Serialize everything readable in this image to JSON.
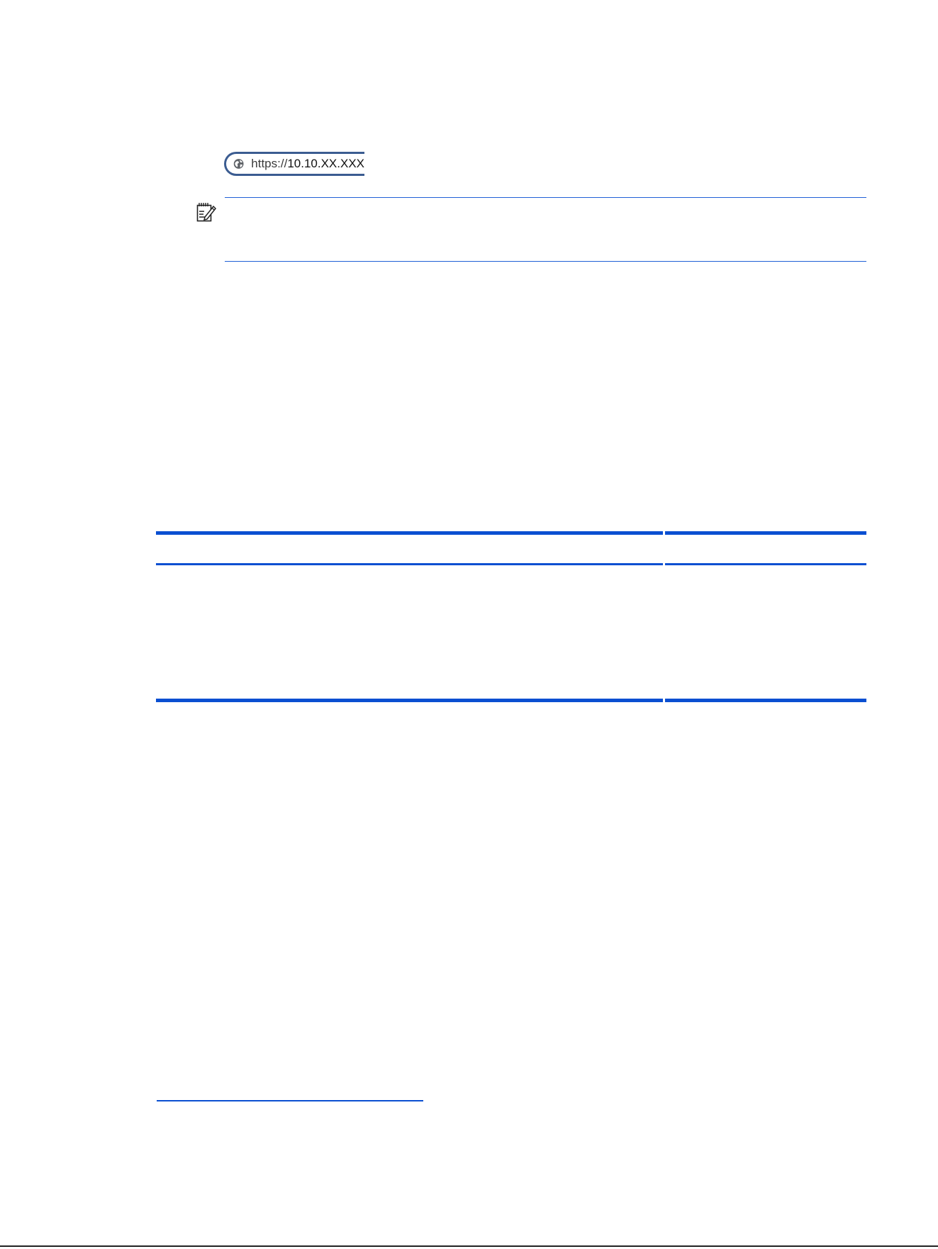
{
  "address_bar": {
    "scheme": "https://",
    "host": "10.10.XX.XXX"
  },
  "icons": {
    "globe": "globe-icon",
    "note": "note-pad-icon"
  },
  "colors": {
    "accent_blue": "#0a4fd1",
    "address_bar_border": "#3b5c91"
  }
}
